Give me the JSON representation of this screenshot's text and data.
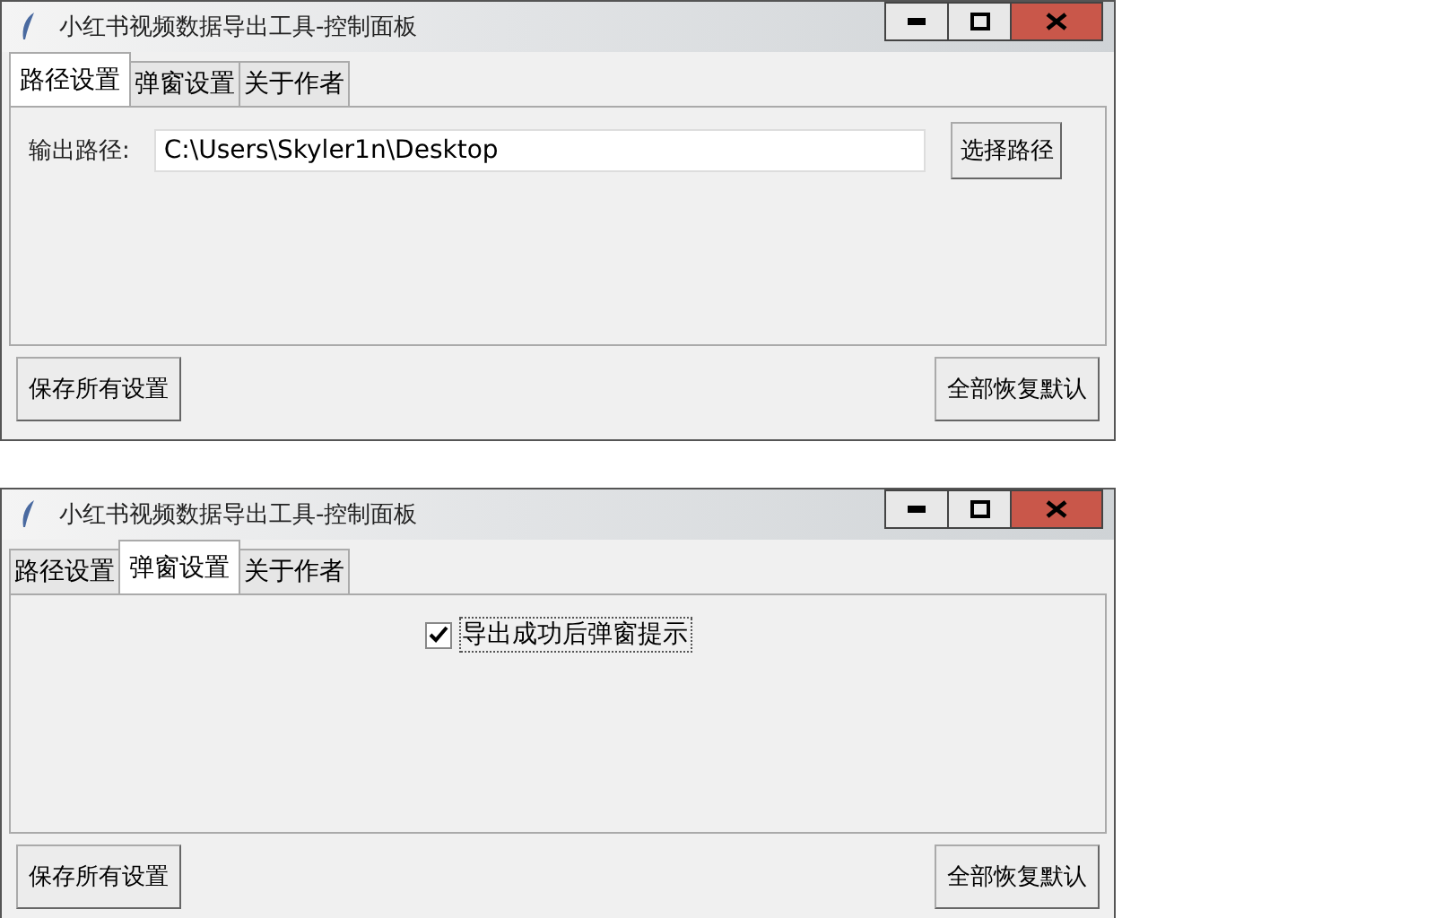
{
  "windows": [
    {
      "title": "小红书视频数据导出工具-控制面板",
      "tabs": [
        {
          "label": "路径设置",
          "selected": true
        },
        {
          "label": "弹窗设置",
          "selected": false
        },
        {
          "label": "关于作者",
          "selected": false
        }
      ],
      "content": {
        "kind": "path",
        "label": "输出路径:",
        "value": "C:\\Users\\Skyler1n\\Desktop",
        "button": "选择路径"
      },
      "buttons": [
        "保存所有设置",
        "全部恢复默认"
      ]
    },
    {
      "title": "小红书视频数据导出工具-控制面板",
      "tabs": [
        {
          "label": "路径设置",
          "selected": false
        },
        {
          "label": "弹窗设置",
          "selected": true
        },
        {
          "label": "关于作者",
          "selected": false
        }
      ],
      "content": {
        "kind": "checkbox",
        "label": "导出成功后弹窗提示",
        "checked": true
      },
      "buttons": [
        "保存所有设置",
        "全部恢复默认"
      ]
    }
  ]
}
